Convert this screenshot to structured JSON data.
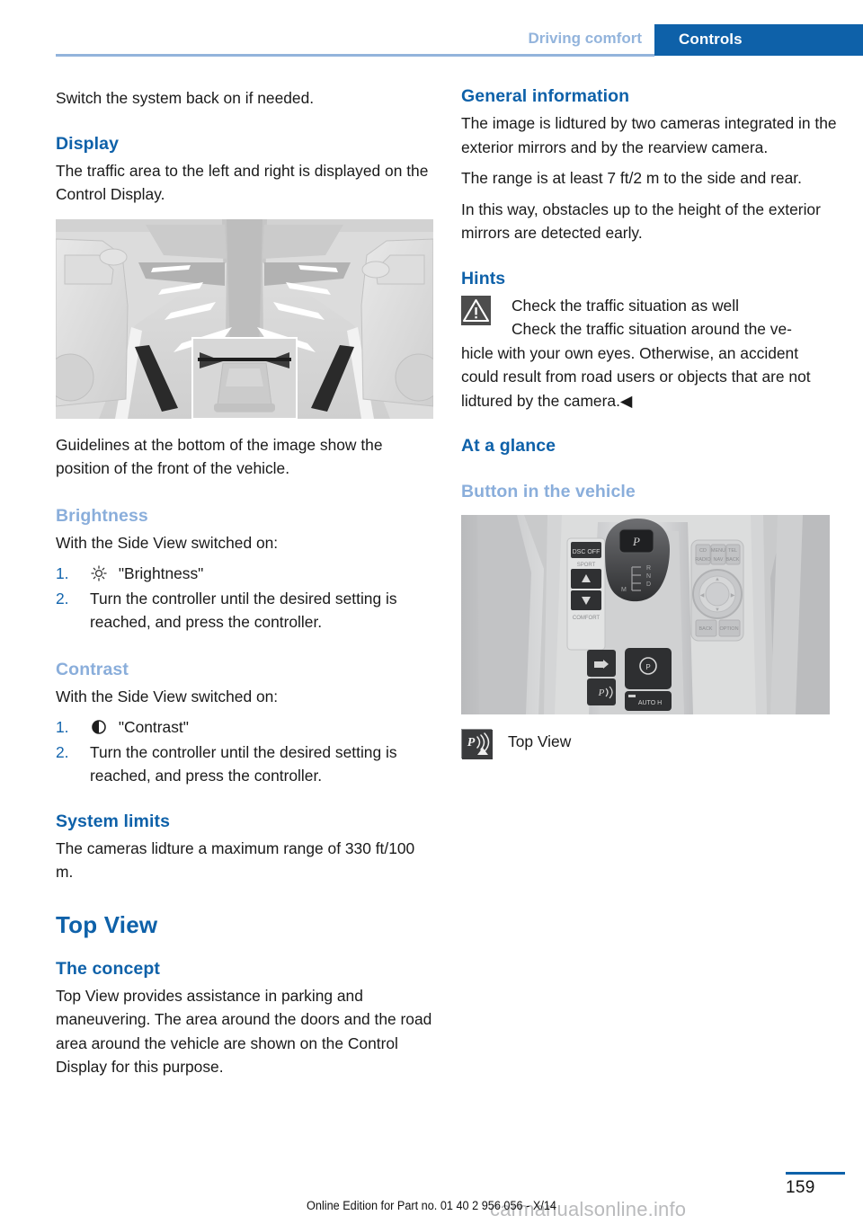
{
  "header": {
    "chapter": "Driving comfort",
    "section_tab": "Controls"
  },
  "left_column": {
    "intro": "Switch the system back on if needed.",
    "display": {
      "heading": "Display",
      "paragraph": "The traffic area to the left and right is displayed on the Control Display.",
      "figure_alt": "side-view-camera-display-illustration",
      "caption": "Guidelines at the bottom of the image show the position of the front of the vehicle."
    },
    "brightness": {
      "heading": "Brightness",
      "lead": "With the Side View switched on:",
      "steps": [
        {
          "num": "1.",
          "icon": "brightness-sun-icon",
          "text": "\"Brightness\""
        },
        {
          "num": "2.",
          "icon": "",
          "text": "Turn the controller until the desired setting is reached, and press the controller."
        }
      ]
    },
    "contrast": {
      "heading": "Contrast",
      "lead": "With the Side View switched on:",
      "steps": [
        {
          "num": "1.",
          "icon": "contrast-half-circle-icon",
          "text": "\"Contrast\""
        },
        {
          "num": "2.",
          "icon": "",
          "text": "Turn the controller until the desired setting is reached, and press the controller."
        }
      ]
    },
    "system_limits": {
      "heading": "System limits",
      "paragraph": "The cameras lidture a maximum range of 330 ft/100 m."
    },
    "top_view": {
      "title": "Top View",
      "concept_heading": "The concept",
      "concept_paragraph": "Top View provides assistance in parking and maneuvering. The area around the doors and the road area around the vehicle are shown on the Control Display for this purpose."
    }
  },
  "right_column": {
    "general_information": {
      "heading": "General information",
      "paragraphs": [
        "The image is lidtured by two cameras integrated in the exterior mirrors and by the rearview camera.",
        "The range is at least 7 ft/2 m to the side and rear.",
        "In this way, obstacles up to the height of the exterior mirrors are detected early."
      ]
    },
    "hints": {
      "heading": "Hints",
      "warning_icon": "warning-triangle-icon",
      "line1": "Check the traffic situation as well",
      "line2_lead": "Check the traffic situation around the ve-",
      "body": "hicle with your own eyes. Otherwise, an accident could result from road users or objects that are not lidtured by the camera.◀"
    },
    "at_a_glance": {
      "heading": "At a glance",
      "subheading": "Button in the vehicle",
      "figure_alt": "center-console-buttons-illustration",
      "button_icon": "top-view-parking-button-icon",
      "button_caption": "Top View"
    }
  },
  "footer": {
    "page_number": "159",
    "edition": "Online Edition for Part no. 01 40 2 956 056 - X/14",
    "watermark": "carmanualsonline.info"
  },
  "colors": {
    "accent_blue": "#0e61a9",
    "light_blue": "#8aaedb",
    "header_chapter": "#93b4dc",
    "body_text": "#1a1a1a"
  }
}
